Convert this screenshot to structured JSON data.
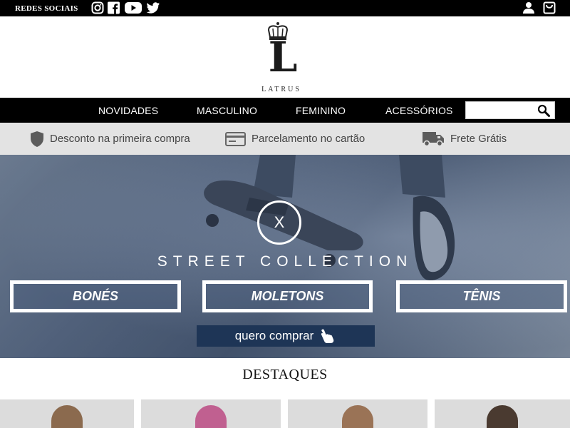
{
  "topbar": {
    "social_label": "REDES SOCIAIS",
    "icons": [
      "instagram-icon",
      "facebook-icon",
      "youtube-icon",
      "twitter-icon"
    ],
    "right_icons": [
      "user-icon",
      "cart-icon"
    ]
  },
  "logo": {
    "letter": "L",
    "word": "LATRUS"
  },
  "nav": {
    "items": [
      "NOVIDADES",
      "MASCULINO",
      "FEMININO",
      "ACESSÓRIOS"
    ],
    "search_value": ""
  },
  "benefits": [
    {
      "icon": "shield-icon",
      "label": "Desconto na primeira compra"
    },
    {
      "icon": "credit-card-icon",
      "label": "Parcelamento no cartão"
    },
    {
      "icon": "truck-icon",
      "label": "Frete Grátis"
    }
  ],
  "hero": {
    "close": "X",
    "title": "STREET COLLECTION",
    "categories": [
      "BONÉS",
      "MOLETONS",
      "TÊNIS"
    ],
    "buy_label": "quero comprar"
  },
  "highlights": {
    "title": "DESTAQUES"
  },
  "colors": {
    "black": "#000000",
    "benefits_bg": "#e3e3e3",
    "hero_button": "#1e3556"
  }
}
